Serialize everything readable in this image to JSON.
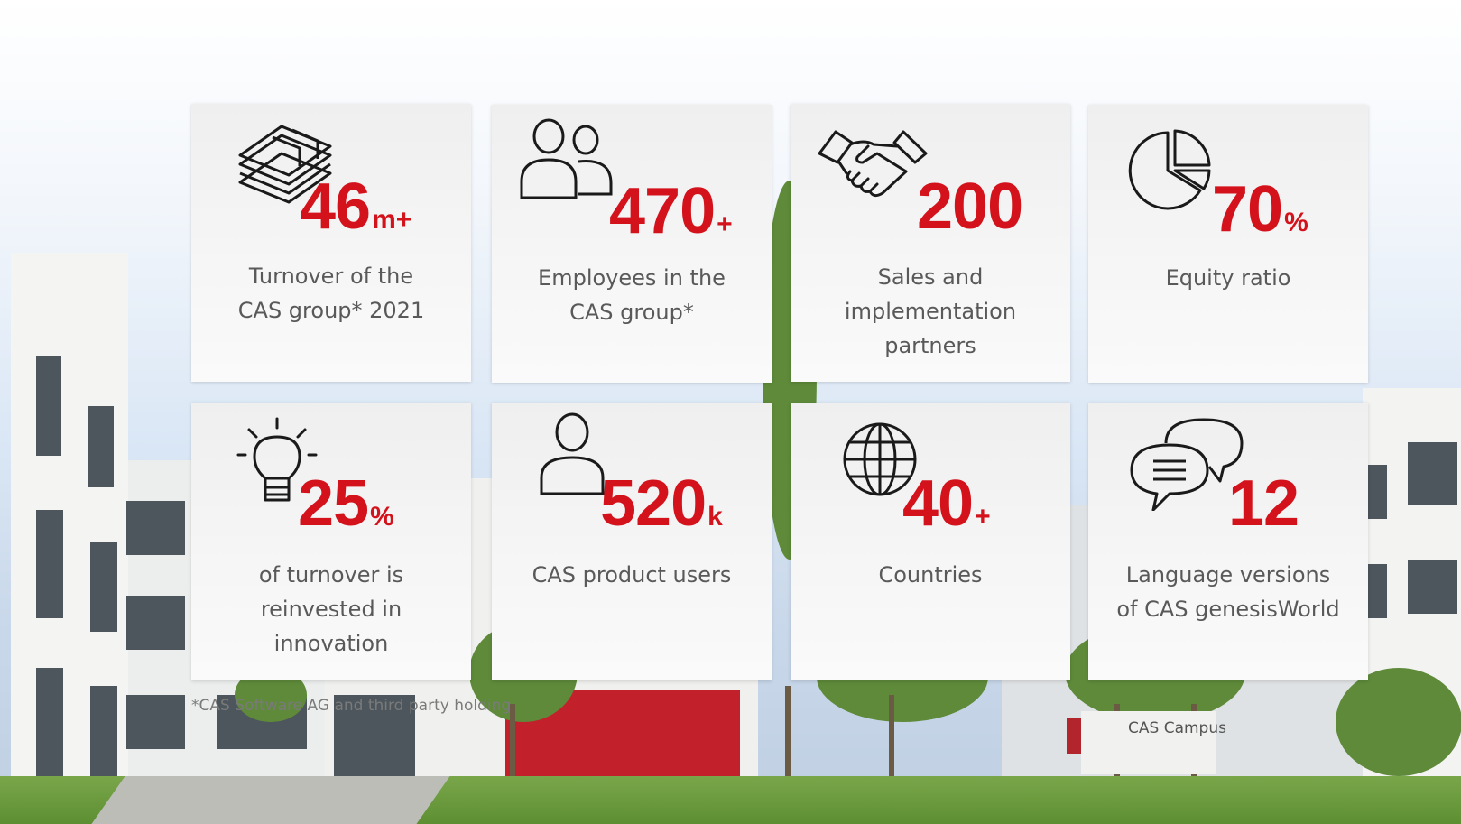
{
  "stats": [
    {
      "value": "46",
      "suffix": "m+",
      "label_lines": [
        "Turnover of the",
        "CAS group* 2021"
      ],
      "icon": "money-stack-icon"
    },
    {
      "value": "470",
      "suffix": "+",
      "label_lines": [
        "Employees in the",
        "CAS group*"
      ],
      "icon": "people-icon"
    },
    {
      "value": "200",
      "suffix": "",
      "label_lines": [
        "Sales and",
        "implementation",
        "partners"
      ],
      "icon": "handshake-icon"
    },
    {
      "value": "70",
      "suffix": "%",
      "label_lines": [
        "Equity ratio"
      ],
      "icon": "pie-chart-icon"
    },
    {
      "value": "25",
      "suffix": "%",
      "label_lines": [
        "of turnover is",
        "reinvested in",
        "innovation"
      ],
      "icon": "lightbulb-icon"
    },
    {
      "value": "520",
      "suffix": "k",
      "label_lines": [
        "CAS product users"
      ],
      "icon": "user-icon"
    },
    {
      "value": "40",
      "suffix": "+",
      "label_lines": [
        "Countries"
      ],
      "icon": "globe-icon"
    },
    {
      "value": "12",
      "suffix": "",
      "label_lines": [
        "Language versions",
        "of CAS genesisWorld"
      ],
      "icon": "speech-bubbles-icon"
    }
  ],
  "footnote": "*CAS Software AG and third party holding",
  "campus_sign": "CAS Campus",
  "colors": {
    "accent": "#d3121b",
    "label": "#595959"
  }
}
